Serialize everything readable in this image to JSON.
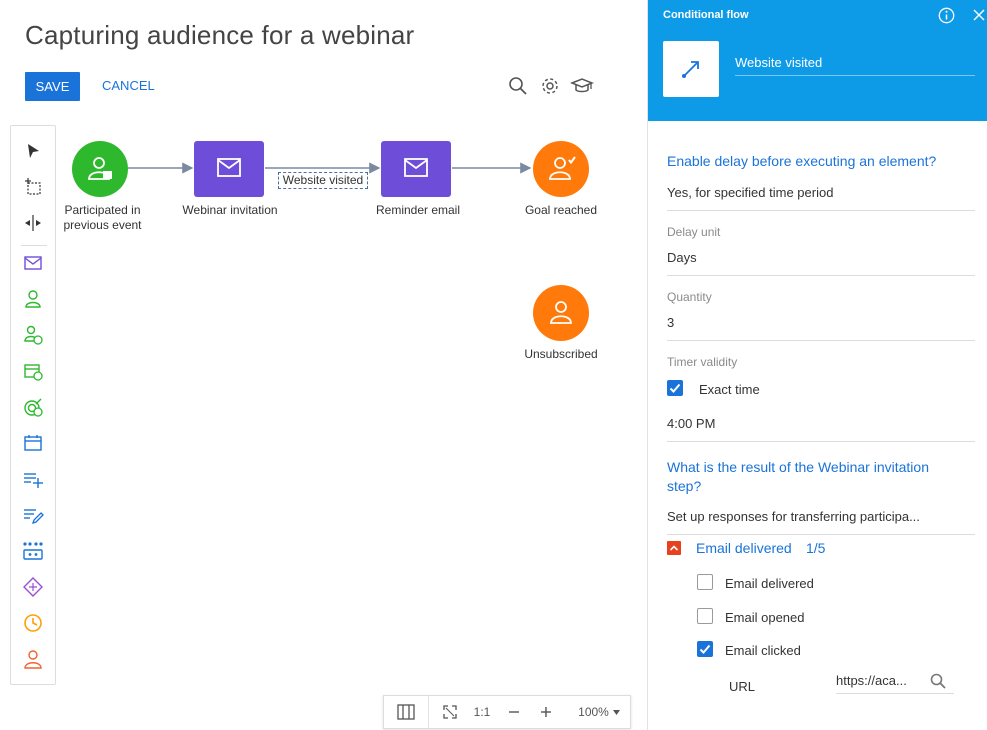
{
  "page": {
    "title": "Capturing audience for a webinar"
  },
  "toolbar": {
    "save_label": "SAVE",
    "cancel_label": "CANCEL"
  },
  "canvas": {
    "nodes": [
      {
        "label_line1": "Participated in",
        "label_line2": "previous event"
      },
      {
        "label": "Webinar invitation"
      },
      {
        "label": "Reminder email"
      },
      {
        "label": "Goal reached"
      },
      {
        "label": "Unsubscribed"
      }
    ],
    "edge_label": "Website visited",
    "colors": {
      "green": "#2eb82e",
      "purple": "#6e4ed9",
      "orange": "#ff7a0a",
      "edge": "#7a8aa0"
    }
  },
  "zoombar": {
    "fit_label": "1:1",
    "zoom_value": "100%"
  },
  "panel": {
    "header_title": "Conditional flow",
    "element_name": "Website visited",
    "delay_question": "Enable delay before executing an element?",
    "delay_answer": "Yes, for specified time period",
    "delay_unit_label": "Delay unit",
    "delay_unit_value": "Days",
    "quantity_label": "Quantity",
    "quantity_value": "3",
    "timer_label": "Timer validity",
    "exact_time_label": "Exact time",
    "time_value": "4:00 PM",
    "result_question": "What is the result of the Webinar invitation step?",
    "result_answer": "Set up responses for transferring participa...",
    "group_label": "Email delivered",
    "group_count": "1/5",
    "options": [
      {
        "label": "Email delivered",
        "checked": false
      },
      {
        "label": "Email opened",
        "checked": false
      },
      {
        "label": "Email clicked",
        "checked": true
      }
    ],
    "url_label": "URL",
    "url_value": "https://aca...",
    "accent": "#0d9be8"
  }
}
